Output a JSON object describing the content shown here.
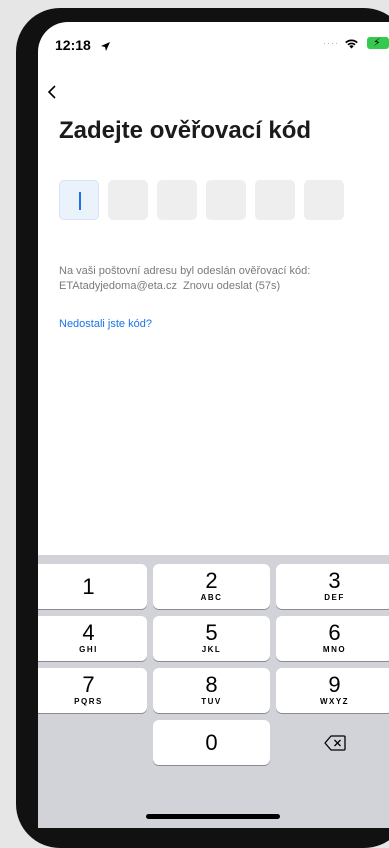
{
  "status_bar": {
    "time": "12:18"
  },
  "header": {
    "title": "Zadejte ověřovací kód"
  },
  "code_input": {
    "length": 6,
    "filled": 0,
    "active_index": 0
  },
  "info": {
    "message": "Na vaši poštovní adresu byl odeslán ověřovací kód:",
    "email": "ETAtadyjedoma@eta.cz",
    "resend": "Znovu odeslat (57s)"
  },
  "help_link": "Nedostali jste kód?",
  "keyboard": {
    "keys": [
      {
        "num": "1",
        "letters": ""
      },
      {
        "num": "2",
        "letters": "ABC"
      },
      {
        "num": "3",
        "letters": "DEF"
      },
      {
        "num": "4",
        "letters": "GHI"
      },
      {
        "num": "5",
        "letters": "JKL"
      },
      {
        "num": "6",
        "letters": "MNO"
      },
      {
        "num": "7",
        "letters": "PQRS"
      },
      {
        "num": "8",
        "letters": "TUV"
      },
      {
        "num": "9",
        "letters": "WXYZ"
      },
      {
        "num": "0",
        "letters": ""
      }
    ]
  },
  "colors": {
    "accent": "#1a73e8",
    "battery": "#36c94f",
    "keyboard_bg": "#d1d3d9"
  }
}
